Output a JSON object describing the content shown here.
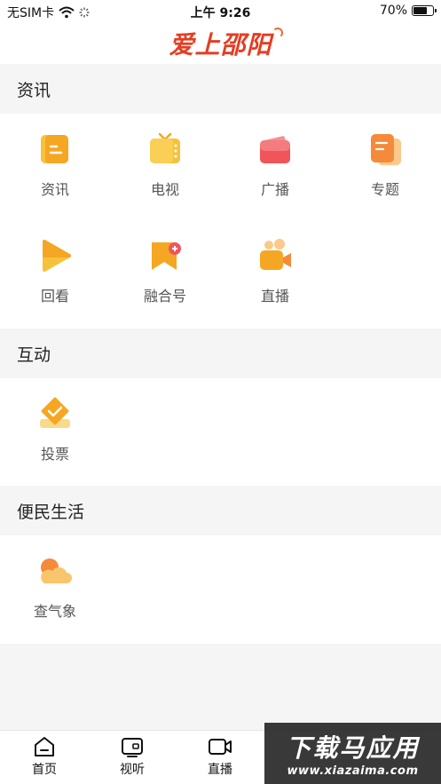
{
  "status_bar": {
    "carrier": "无SIM卡",
    "time": "上午 9:26",
    "battery": "70%",
    "battery_level": 0.7
  },
  "header": {
    "logo_text": "爱上邵阳"
  },
  "sections": [
    {
      "title": "资讯",
      "items": [
        {
          "label": "资讯",
          "icon": "document-icon"
        },
        {
          "label": "电视",
          "icon": "tv-icon"
        },
        {
          "label": "广播",
          "icon": "radio-icon"
        },
        {
          "label": "专题",
          "icon": "topic-icon"
        },
        {
          "label": "回看",
          "icon": "play-icon"
        },
        {
          "label": "融合号",
          "icon": "bookmark-plus-icon"
        },
        {
          "label": "直播",
          "icon": "live-camera-icon"
        }
      ]
    },
    {
      "title": "互动",
      "items": [
        {
          "label": "投票",
          "icon": "vote-icon"
        }
      ]
    },
    {
      "title": "便民生活",
      "items": [
        {
          "label": "查气象",
          "icon": "weather-icon"
        }
      ]
    }
  ],
  "tabbar": [
    {
      "label": "首页",
      "icon": "home-icon"
    },
    {
      "label": "视听",
      "icon": "media-icon"
    },
    {
      "label": "直播",
      "icon": "video-camera-icon"
    }
  ],
  "watermark": {
    "cn": "下载马应用",
    "en": "www.xiazaima.com"
  },
  "colors": {
    "accent": "#e53d22",
    "icon_orange": "#f5a623",
    "icon_red": "#f0555a",
    "section_bg": "#f5f5f5"
  }
}
